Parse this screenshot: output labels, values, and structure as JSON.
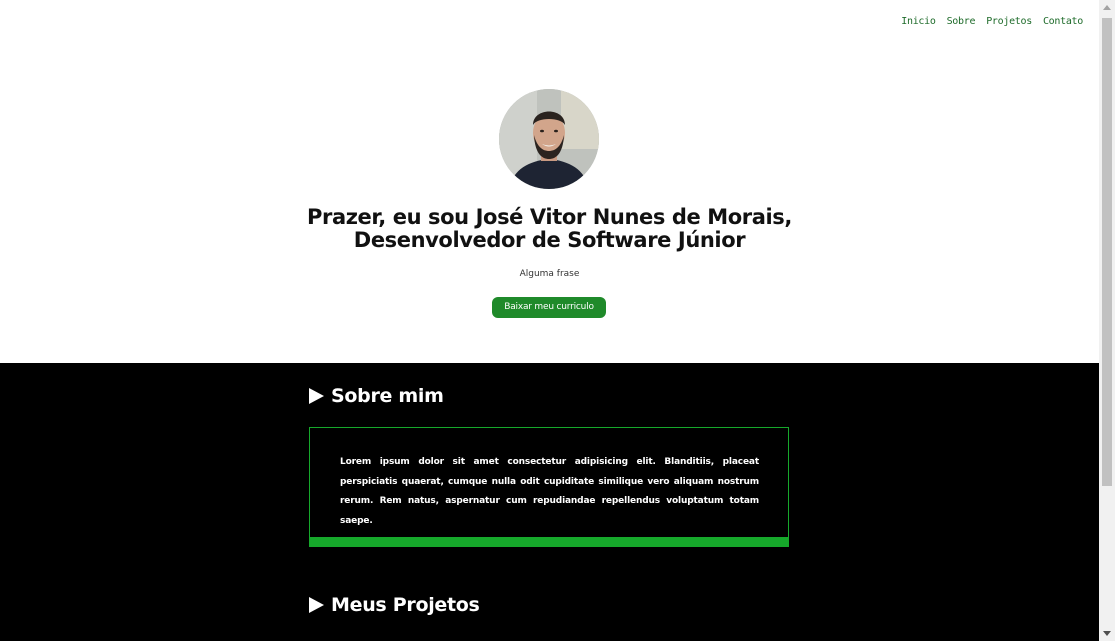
{
  "nav": {
    "items": [
      {
        "label": "Inicio"
      },
      {
        "label": "Sobre"
      },
      {
        "label": "Projetos"
      },
      {
        "label": "Contato"
      }
    ]
  },
  "hero": {
    "title_line1": "Prazer, eu sou José Vitor Nunes de Morais,",
    "title_line2": "Desenvolvedor de Software Júnior",
    "subtitle": "Alguma frase",
    "cv_button_label": "Baixar meu curriculo"
  },
  "about": {
    "heading": "Sobre mim",
    "text": "Lorem ipsum dolor sit amet consectetur adipisicing elit. Blanditiis, placeat perspiciatis quaerat, cumque nulla odit cupiditate similique vero aliquam nostrum rerum. Rem natus, aspernatur cum repudiandae repellendus voluptatum totam saepe."
  },
  "projects": {
    "heading": "Meus Projetos"
  },
  "colors": {
    "accent_green": "#1f8a2a",
    "box_border_green": "#16a82b",
    "nav_green": "#1e6b2a",
    "dark_bg": "#000000"
  }
}
